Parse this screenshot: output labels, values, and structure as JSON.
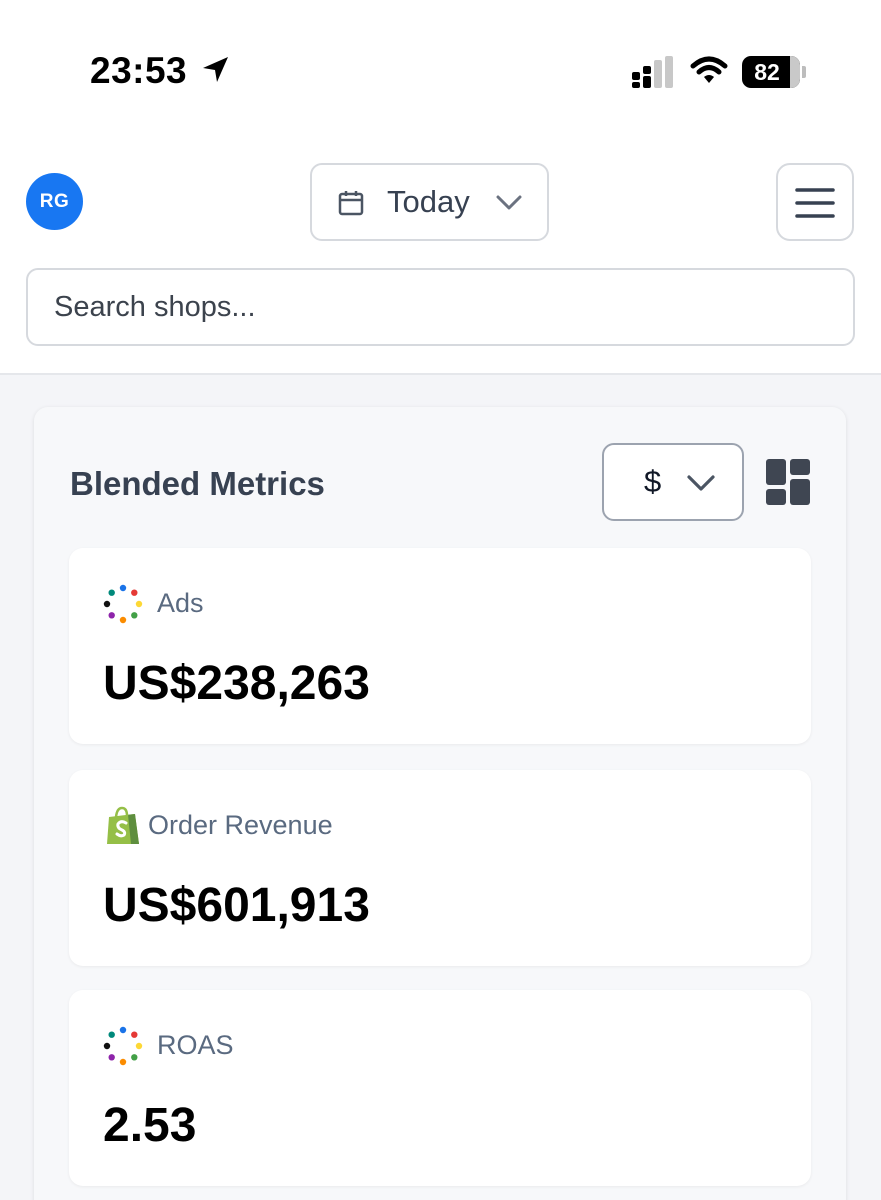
{
  "status_bar": {
    "time": "23:53",
    "battery_level": "82",
    "icons": [
      "location-arrow-icon",
      "cellular-signal-icon",
      "wifi-icon",
      "battery-icon"
    ]
  },
  "header": {
    "avatar_initials": "RG",
    "date_range": {
      "label": "Today",
      "icons": [
        "calendar-icon",
        "chevron-down-icon"
      ]
    },
    "menu_icon": "hamburger-menu-icon"
  },
  "search": {
    "placeholder": "Search shops..."
  },
  "panel": {
    "title": "Blended Metrics",
    "currency": "$",
    "layout_icon": "dashboard-layout-icon"
  },
  "metrics": [
    {
      "label": "Ads",
      "value": "US$238,263",
      "icon": "triple-whale-dots-icon"
    },
    {
      "label": "Order Revenue",
      "value": "US$601,913",
      "icon": "shopify-bag-icon"
    },
    {
      "label": "ROAS",
      "value": "2.53",
      "icon": "triple-whale-dots-icon"
    }
  ],
  "colors": {
    "accent": "#1877f2",
    "border": "#d6d9de",
    "label_gray": "#5a6a80",
    "panel_bg": "#f7f8fa",
    "shopify_green": "#95bf47"
  }
}
